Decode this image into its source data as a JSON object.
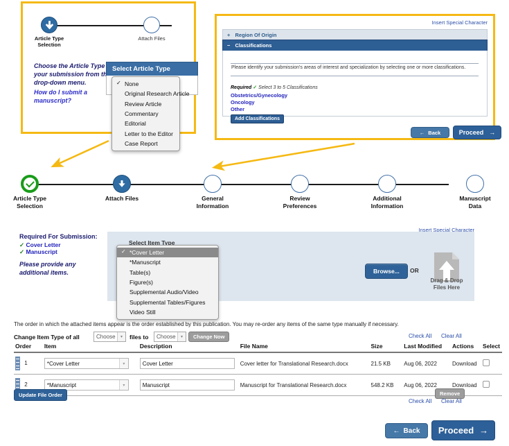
{
  "callout_left": {
    "steps": [
      {
        "label": "Article Type\nSelection",
        "state": "current"
      },
      {
        "label": "Attach Files",
        "state": "pending"
      }
    ],
    "instruction_1": "Choose the Article Type of your submission from the drop-down menu.",
    "instruction_2": "How do I submit a manuscript?",
    "select_header": "Select Article Type",
    "article_type_options": [
      {
        "label": "None",
        "selected": true
      },
      {
        "label": "Original Research Article",
        "selected": false
      },
      {
        "label": "Review Article",
        "selected": false
      },
      {
        "label": "Commentary",
        "selected": false
      },
      {
        "label": "Editorial",
        "selected": false
      },
      {
        "label": "Letter to the Editor",
        "selected": false
      },
      {
        "label": "Case Report",
        "selected": false
      }
    ]
  },
  "callout_right": {
    "insert_special_character": "Insert Special Character",
    "accordion_closed_label": "Region Of Origin",
    "accordion_closed_sign": "+",
    "accordion_open_label": "Classifications",
    "accordion_open_sign": "−",
    "body_text": "Please identify your submission's areas of interest and specialization by selecting one or more classifications.",
    "required_label": "Required",
    "required_check": "✓",
    "required_hint": "Select 3 to 5 Classifications",
    "classifications": [
      "Obstetrics/Gynecology",
      "Oncology",
      "Other"
    ],
    "add_classifications_label": "Add Classifications",
    "back_label": "Back",
    "proceed_label": "Proceed"
  },
  "progress": {
    "steps": [
      {
        "label_line1": "Article Type",
        "label_line2": "Selection",
        "state": "done"
      },
      {
        "label_line1": "Attach Files",
        "label_line2": "",
        "state": "current"
      },
      {
        "label_line1": "General",
        "label_line2": "Information",
        "state": "pending"
      },
      {
        "label_line1": "Review",
        "label_line2": "Preferences",
        "state": "pending"
      },
      {
        "label_line1": "Additional",
        "label_line2": "Information",
        "state": "pending"
      },
      {
        "label_line1": "Manuscript",
        "label_line2": "Data",
        "state": "pending"
      }
    ]
  },
  "attach": {
    "required_heading": "Required For Submission:",
    "required_items": [
      "Cover Letter",
      "Manuscript"
    ],
    "additional_note": "Please provide any additional items.",
    "insert_special_character": "Insert Special Character",
    "select_item_type_header": "Select Item Type",
    "item_type_options": [
      {
        "label": "*Cover Letter",
        "selected": true
      },
      {
        "label": "*Manuscript",
        "selected": false
      },
      {
        "label": "Table(s)",
        "selected": false
      },
      {
        "label": "Figure(s)",
        "selected": false
      },
      {
        "label": "Supplemental Audio/Video",
        "selected": false
      },
      {
        "label": "Supplemental Tables/Figures",
        "selected": false
      },
      {
        "label": "Video Still",
        "selected": false
      }
    ],
    "browse_label": "Browse...",
    "or_label": "OR",
    "drag_drop_line1": "Drag & Drop",
    "drag_drop_line2": "Files Here"
  },
  "file_table": {
    "note": "The order in which the attached items appear is the order established by this publication. You may re-order any items of the same type manually if necessary.",
    "change_prefix": "Change Item Type of all",
    "change_middle": "files to",
    "change_select_1": "Choose",
    "change_select_2": "Choose",
    "change_now_label": "Change Now",
    "check_all_label": "Check All",
    "clear_all_label": "Clear All",
    "columns": [
      "Order",
      "Item",
      "Description",
      "File Name",
      "Size",
      "Last Modified",
      "Actions",
      "Select"
    ],
    "rows": [
      {
        "order": "1",
        "item": "*Cover Letter",
        "description": "Cover Letter",
        "file_name": "Cover letter for Translational Research.docx",
        "size": "21.5 KB",
        "last_modified": "Aug 06, 2022",
        "action": "Download"
      },
      {
        "order": "2",
        "item": "*Manuscript",
        "description": "Manuscript",
        "file_name": "Manuscript for Translational Research.docx",
        "size": "548.2 KB",
        "last_modified": "Aug 06, 2022",
        "action": "Download"
      }
    ],
    "update_file_order_label": "Update File Order",
    "remove_label": "Remove",
    "footer_check_all": "Check All",
    "footer_clear_all": "Clear All"
  },
  "footer": {
    "back_label": "Back",
    "proceed_label": "Proceed"
  },
  "colors": {
    "highlight": "#f5b913",
    "header_blue": "#3a6ea5",
    "accordion_blue": "#2d5e94",
    "panel_blue": "#dde5ee",
    "done_green": "#1a9b1a",
    "current_blue": "#2e6ca4",
    "link_blue": "#2b4ea8"
  }
}
